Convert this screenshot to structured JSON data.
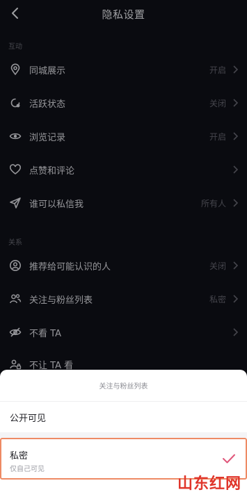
{
  "header": {
    "title": "隐私设置"
  },
  "sections": {
    "interaction": "互动",
    "relations": "关系"
  },
  "rows": [
    {
      "label": "同城展示",
      "value": "开启",
      "icon": "location-pin-icon"
    },
    {
      "label": "活跃状态",
      "value": "关闭",
      "icon": "activity-status-icon"
    },
    {
      "label": "浏览记录",
      "value": "开启",
      "icon": "eye-icon"
    },
    {
      "label": "点赞和评论",
      "value": "",
      "icon": "heart-icon"
    },
    {
      "label": "谁可以私信我",
      "value": "所有人",
      "icon": "send-icon"
    },
    {
      "label": "推荐给可能认识的人",
      "value": "关闭",
      "icon": "person-circle-icon"
    },
    {
      "label": "关注与粉丝列表",
      "value": "私密",
      "icon": "users-icon"
    },
    {
      "label": "不看 TA",
      "value": "",
      "icon": "eye-off-icon"
    },
    {
      "label": "不让 TA 看",
      "value": "",
      "icon": "user-lock-icon"
    }
  ],
  "sheet": {
    "title": "关注与粉丝列表",
    "option_public": "公开可见",
    "option_private": "私密",
    "option_private_desc": "仅自己可见"
  },
  "watermark": "山东红网",
  "colors": {
    "background": "#0e0f16",
    "sheet": "#ffffff",
    "check": "#e0567a",
    "highlight_border": "#ee8a64"
  }
}
